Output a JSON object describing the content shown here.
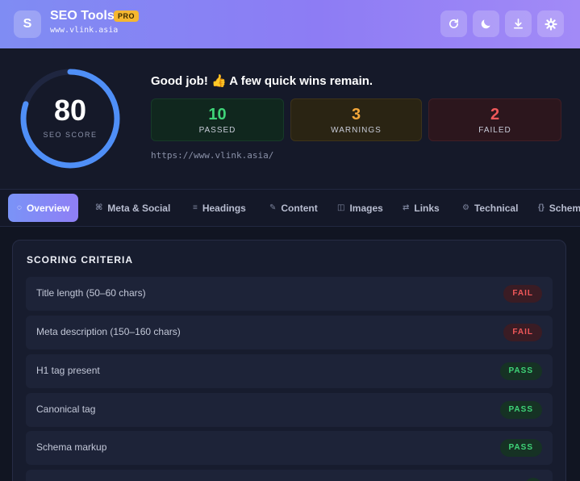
{
  "header": {
    "logo_letter": "S",
    "title": "SEO Tools",
    "badge": "PRO",
    "domain": "www.vlink.asia",
    "buttons": [
      {
        "name": "refresh",
        "icon": "refresh-icon"
      },
      {
        "name": "theme",
        "icon": "moon-icon"
      },
      {
        "name": "download",
        "icon": "download-icon"
      },
      {
        "name": "settings",
        "icon": "gear-icon"
      }
    ]
  },
  "score": {
    "value": "80",
    "fraction": 0.8,
    "label": "SEO SCORE",
    "headline": "Good job! 👍 A few quick wins remain.",
    "url": "https://www.vlink.asia/",
    "stats": {
      "passed": {
        "value": "10",
        "label": "PASSED"
      },
      "warnings": {
        "value": "3",
        "label": "WARNINGS"
      },
      "failed": {
        "value": "2",
        "label": "FAILED"
      }
    }
  },
  "tabs": [
    {
      "label": "Overview",
      "icon": "◌",
      "active": true
    },
    {
      "label": "Meta & Social",
      "icon": "⌘"
    },
    {
      "label": "Headings",
      "icon": "≡"
    },
    {
      "label": "Content",
      "icon": "✎"
    },
    {
      "label": "Images",
      "icon": "◫"
    },
    {
      "label": "Links",
      "icon": "⇄"
    },
    {
      "label": "Technical",
      "icon": "⚙"
    },
    {
      "label": "Schem",
      "icon": "{}"
    }
  ],
  "criteria": {
    "title": "SCORING CRITERIA",
    "rows": [
      {
        "label": "Title length (50–60 chars)",
        "status": "FAIL"
      },
      {
        "label": "Meta description (150–160 chars)",
        "status": "FAIL"
      },
      {
        "label": "H1 tag present",
        "status": "PASS"
      },
      {
        "label": "Canonical tag",
        "status": "PASS"
      },
      {
        "label": "Schema markup",
        "status": "PASS"
      }
    ]
  },
  "colors": {
    "accent": "#7f8cf3",
    "pass": "#3fd478",
    "warn": "#f4a73a",
    "fail": "#f0585a",
    "ring": "#4f8ff7"
  }
}
